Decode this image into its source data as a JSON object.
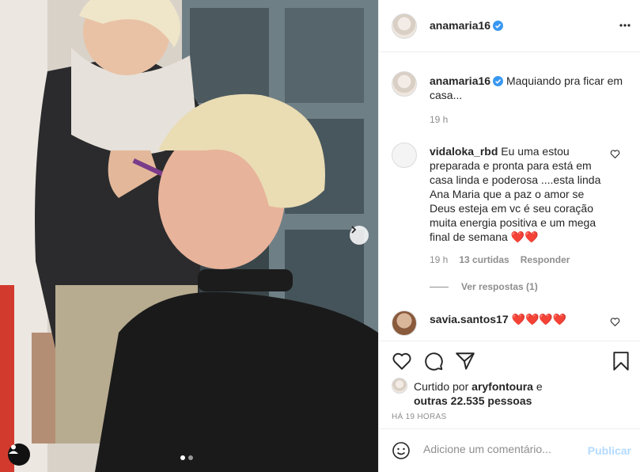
{
  "post": {
    "author": "anamaria16",
    "more_icon": "ellipsis-icon",
    "caption_author": "anamaria16",
    "caption_text": "Maquiando pra ficar em casa...",
    "caption_time": "19 h"
  },
  "comments": [
    {
      "user": "vidaloka_rbd",
      "text": "Eu uma estou preparada e pronta para está em casa linda e poderosa ....esta linda Ana Maria que a paz o amor se Deus esteja em vc é seu coração muita energia positiva e um mega final de semana ❤️❤️",
      "time": "19 h",
      "likes": "13 curtidas",
      "reply": "Responder",
      "view_replies": "Ver respostas (1)"
    },
    {
      "user": "savia.santos17",
      "text": "❤️❤️❤️❤️"
    }
  ],
  "likes": {
    "prefix": "Curtido por",
    "user": "aryfontoura",
    "mid": "e",
    "others": "outras 22.535 pessoas"
  },
  "time_ago": "HÁ 19 HORAS",
  "add_comment": {
    "placeholder": "Adicione um comentário...",
    "publish": "Publicar"
  },
  "carousel": {
    "current": 1,
    "total": 2
  },
  "colors": {
    "accent": "#0095f6",
    "heart": "#ed4956",
    "publish_disabled": "#b3dbff"
  }
}
